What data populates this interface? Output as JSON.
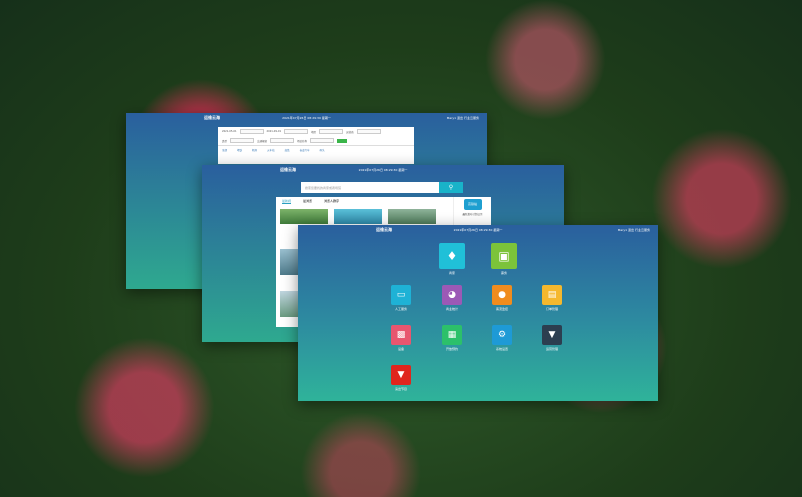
{
  "window1": {
    "logo": "运维云海",
    "clock": "2021年07月26日 08:29:30 星期一",
    "user": "Mary1  退出  行业云服务",
    "filter_row1": [
      "2021-05-01",
      "2021-09-01",
      "地区",
      "运营商",
      "商家"
    ],
    "filter_row2": [
      "类型",
      "全部",
      "交通枢纽",
      "场馆名称"
    ],
    "search_label": "搜索",
    "tabs": [
      "全部",
      "地铁",
      "机场",
      "火车站",
      "高铁",
      "长途汽车",
      "码头"
    ]
  },
  "window2": {
    "logo": "运维云海",
    "clock": "2021年07月26日 08:29:30 星期一",
    "search_placeholder": "搜索您要找的商家或者场馆",
    "tabs": [
      "最新视",
      "最浏览",
      "浏览人群序"
    ],
    "thumb_captions": [
      "新世界",
      "深海乐园",
      "城市公园"
    ],
    "side_badge": "高铁站",
    "side_text": "最新发布计划公示"
  },
  "window3": {
    "logo": "运维云海",
    "clock": "2021年07月26日 08:29:30 星期一",
    "user": "Mary1  退出  行业云服务",
    "apps": [
      {
        "label": "商家",
        "color": "#20c0d8",
        "icon": "tag-icon"
      },
      {
        "label": "票务",
        "color": "#7cc33a",
        "icon": "ticket-icon"
      },
      {
        "label": "人工服务",
        "color": "#1eb2d6",
        "icon": "card-icon"
      },
      {
        "label": "商业统计",
        "color": "#9b59b6",
        "icon": "pie-chart-icon"
      },
      {
        "label": "客流监控",
        "color": "#f08c1e",
        "icon": "person-icon"
      },
      {
        "label": "订单管理",
        "color": "#f5b82e",
        "icon": "order-icon"
      },
      {
        "label": "设备",
        "color": "#e8566f",
        "icon": "device-icon"
      },
      {
        "label": "开放预约",
        "color": "#2cc06a",
        "icon": "calendar-icon"
      },
      {
        "label": "系统设置",
        "color": "#1e9ad6",
        "icon": "gear-icon"
      },
      {
        "label": "运营管理",
        "color": "#2c3e50",
        "icon": "cocktail-icon"
      },
      {
        "label": "演出节目",
        "color": "#e0251d",
        "icon": "drink-icon"
      }
    ]
  }
}
